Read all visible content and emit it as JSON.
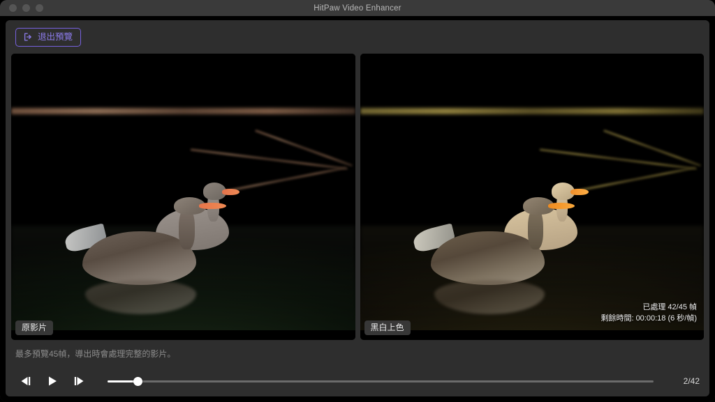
{
  "window": {
    "title": "HitPaw Video Enhancer",
    "traffic_lights": [
      "close-button",
      "minimize-button",
      "zoom-button"
    ]
  },
  "toolbar": {
    "exit_preview_label": "退出預覽",
    "exit_icon": "exit-arrow-icon",
    "accent_color": "#7762df"
  },
  "preview": {
    "original": {
      "label": "原影片"
    },
    "enhanced": {
      "label": "黑白上色",
      "processed_text": "已處理 42/45 幀",
      "remaining_text": "剩餘時間: 00:00:18 (6 秒/幀)"
    }
  },
  "hint": {
    "text": "最多預覽45幀，導出時會處理完整的影片。"
  },
  "transport": {
    "prev_frame_icon": "previous-frame-icon",
    "play_icon": "play-icon",
    "next_frame_icon": "next-frame-icon",
    "frame_counter": "2/42"
  }
}
